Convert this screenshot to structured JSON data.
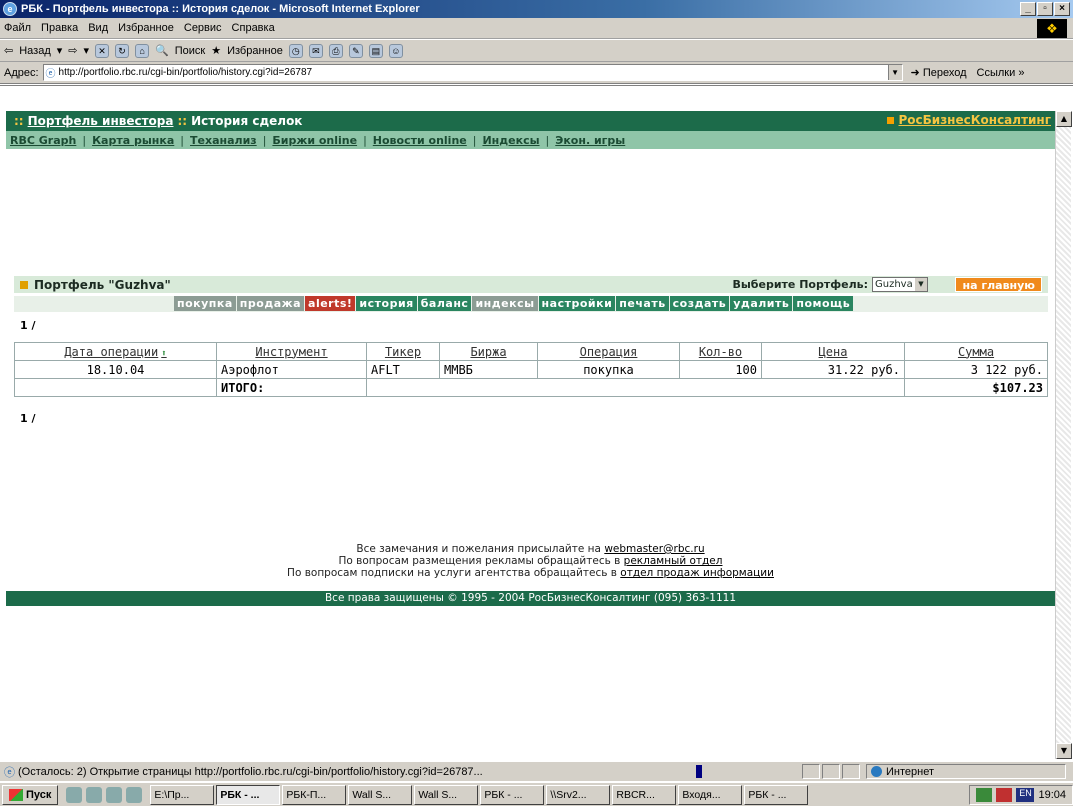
{
  "window": {
    "title": "РБК - Портфель инвестора :: История сделок - Microsoft Internet Explorer"
  },
  "menu": [
    "Файл",
    "Правка",
    "Вид",
    "Избранное",
    "Сервис",
    "Справка"
  ],
  "toolbar": {
    "back": "Назад",
    "search": "Поиск",
    "favorites": "Избранное"
  },
  "address": {
    "label": "Адрес:",
    "url": "http://portfolio.rbc.ru/cgi-bin/portfolio/history.cgi?id=26787",
    "go": "Переход",
    "links": "Ссылки »"
  },
  "header": {
    "sep1": "::",
    "portfolio_link": "Портфель инвестора",
    "sep2": "::",
    "section": "История сделок",
    "rbc": "РосБизнесКонсалтинг"
  },
  "nav": [
    "RBC Graph",
    "Карта рынка",
    "Теханализ",
    "Биржи online",
    "Новости online",
    "Индексы",
    "Экон. игры"
  ],
  "portfolio": {
    "title": "Портфель \"Guzhva\"",
    "choose_label": "Выберите Портфель:",
    "selected": "Guzhva",
    "home": "на главную"
  },
  "tabs": [
    {
      "label": "покупка",
      "style": "grey"
    },
    {
      "label": "продажа",
      "style": "grey"
    },
    {
      "label": "alerts!",
      "style": "red"
    },
    {
      "label": "история",
      "style": "green"
    },
    {
      "label": "баланс",
      "style": "green"
    },
    {
      "label": "индексы",
      "style": "grey"
    },
    {
      "label": "настройки",
      "style": "green"
    },
    {
      "label": "печать",
      "style": "green"
    },
    {
      "label": "создать",
      "style": "green"
    },
    {
      "label": "удалить",
      "style": "green"
    },
    {
      "label": "помощь",
      "style": "green"
    }
  ],
  "pager": {
    "top": "1 /",
    "bottom": "1 /"
  },
  "table": {
    "headers": [
      "Дата операции",
      "Инструмент",
      "Тикер",
      "Биржа",
      "Операция",
      "Кол-во",
      "Цена",
      "Сумма"
    ],
    "rows": [
      [
        "18.10.04",
        "Аэрофлот",
        "AFLT",
        "ММВБ",
        "покупка",
        "100",
        "31.22 руб.",
        "3 122 руб."
      ]
    ],
    "total_label": "ИТОГО:",
    "total_value": "$107.23"
  },
  "footer": {
    "line1_text": "Все замечания и пожелания присылайте на ",
    "line1_link": "webmaster@rbc.ru",
    "line2_text": "По вопросам размещения рекламы обращайтесь в ",
    "line2_link": "рекламный отдел",
    "line3_text": "По вопросам подписки на услуги агентства обращайтесь в ",
    "line3_link": "отдел продаж информации",
    "copyright": "Все права защищены © 1995 - 2004 РосБизнесКонсалтинг (095) 363-1111"
  },
  "status": {
    "text": "(Осталось: 2) Открытие страницы http://portfolio.rbc.ru/cgi-bin/portfolio/history.cgi?id=26787...",
    "zone": "Интернет"
  },
  "taskbar": {
    "start": "Пуск",
    "tasks": [
      "E:\\Пр...",
      "РБК - ...",
      "РБК-П...",
      "Wall S...",
      "Wall S...",
      "РБК - ...",
      "\\\\Srv2...",
      "RBCR...",
      "Входя...",
      "РБК - ..."
    ],
    "active_index": 1,
    "lang": "EN",
    "clock": "19:04"
  },
  "colors": {
    "rbc_green": "#1c6b4a",
    "nav_green": "#8fc5a8",
    "accent_orange": "#f08a1c"
  }
}
